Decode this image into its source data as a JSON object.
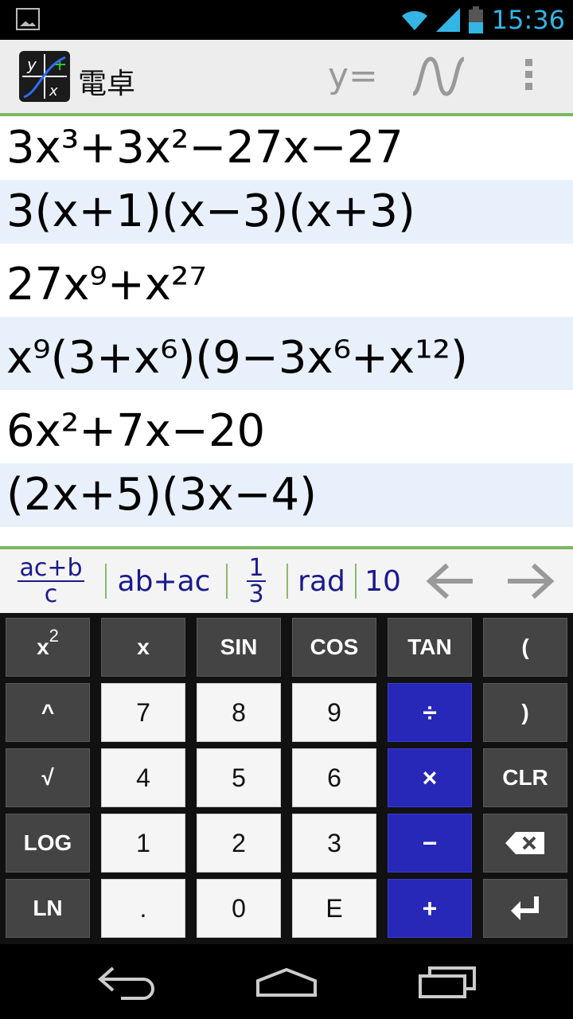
{
  "status": {
    "time": "15:36"
  },
  "app": {
    "title": "電卓",
    "yeq_label": "y=",
    "wave_icon": "graph-wave-icon",
    "menu_icon": "overflow-menu-icon"
  },
  "history": [
    {
      "expr": "3x³+3x²−27x−27"
    },
    {
      "expr": "3(x+1)(x−3)(x+3)"
    },
    {
      "expr": "27x⁹+x²⁷"
    },
    {
      "expr": "x⁹(3+x⁶)(9−3x⁶+x¹²)"
    },
    {
      "expr": "6x²+7x−20"
    },
    {
      "expr": "(2x+5)(3x−4)"
    }
  ],
  "toolbar": {
    "frac_expr_num": "ac+b",
    "frac_expr_den": "c",
    "distribute": "ab+ac",
    "frac_num": "1",
    "frac_den": "3",
    "rad": "rad",
    "base": "10"
  },
  "keys": {
    "x2_base": "x",
    "x2_sup": "2",
    "x": "x",
    "sin": "SIN",
    "cos": "COS",
    "tan": "TAN",
    "lparen": "(",
    "pow": "^",
    "k7": "7",
    "k8": "8",
    "k9": "9",
    "div": "÷",
    "rparen": ")",
    "sqrt": "√",
    "k4": "4",
    "k5": "5",
    "k6": "6",
    "mul": "×",
    "clr": "CLR",
    "log": "LOG",
    "k1": "1",
    "k2": "2",
    "k3": "3",
    "minus": "−",
    "ln": "LN",
    "dot": ".",
    "k0": "0",
    "e": "E",
    "plus": "+"
  },
  "colors": {
    "accent_green": "#7cb664",
    "op_blue": "#2727b8",
    "dark_key": "#444444"
  }
}
